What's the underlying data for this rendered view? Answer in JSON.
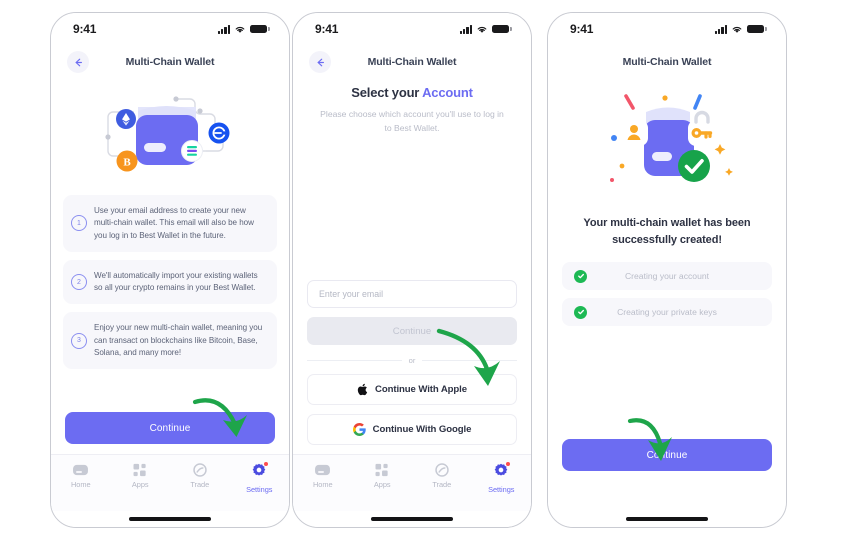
{
  "meta": {
    "accent": "#6c6cf2",
    "success_green": "#1db954",
    "arrow_green": "#1ea54a",
    "muted_text": "#b9bcc8",
    "card_bg": "#f7f7fb"
  },
  "status_bar": {
    "time": "9:41",
    "signal_icon": "cellular-signal-icon",
    "wifi_icon": "wifi-icon",
    "battery_icon": "battery-full-icon"
  },
  "tab_bar": {
    "items": [
      {
        "label": "Home",
        "icon": "home-icon",
        "active": false
      },
      {
        "label": "Apps",
        "icon": "apps-grid-icon",
        "active": false
      },
      {
        "label": "Trade",
        "icon": "trade-swap-icon",
        "active": false
      },
      {
        "label": "Settings",
        "icon": "gear-icon",
        "active": true
      }
    ]
  },
  "screen1": {
    "nav_title": "Multi-Chain Wallet",
    "back_icon": "back-arrow-icon",
    "illustration": "multi-chain-wallet-network-illustration",
    "items": [
      {
        "number": "1",
        "text": "Use your email address to create your new multi-chain wallet. This email will also be how you log in to Best Wallet in the future."
      },
      {
        "number": "2",
        "text": "We'll automatically import your existing wallets so all your crypto remains in your Best Wallet."
      },
      {
        "number": "3",
        "text": "Enjoy your new multi-chain wallet, meaning you can transact on blockchains like Bitcoin, Base, Solana, and many more!"
      }
    ],
    "continue_label": "Continue"
  },
  "screen2": {
    "nav_title": "Multi-Chain Wallet",
    "back_icon": "back-arrow-icon",
    "headline_prefix": "Select your ",
    "headline_accent": "Account",
    "subhead": "Please choose which account you'll use to log in to Best Wallet.",
    "email_placeholder": "Enter your email",
    "email_value": "",
    "continue_label": "Continue",
    "divider_label": "or",
    "apple_label": "Continue With Apple",
    "apple_icon": "apple-logo-icon",
    "google_label": "Continue With Google",
    "google_icon": "google-logo-icon"
  },
  "screen3": {
    "nav_title": "Multi-Chain Wallet",
    "illustration": "wallet-created-success-illustration",
    "title": "Your multi-chain wallet has been successfully created!",
    "steps": [
      {
        "label": "Creating your account",
        "status_icon": "check-circle-icon",
        "done": true
      },
      {
        "label": "Creating your private keys",
        "status_icon": "check-circle-icon",
        "done": true
      }
    ],
    "continue_label": "Continue"
  },
  "annotations": {
    "arrow1": "green-curved-arrow-pointing-to-continue",
    "arrow2": "green-curved-arrow-pointing-to-continue-with-google",
    "arrow3": "green-curved-arrow-pointing-to-continue"
  }
}
